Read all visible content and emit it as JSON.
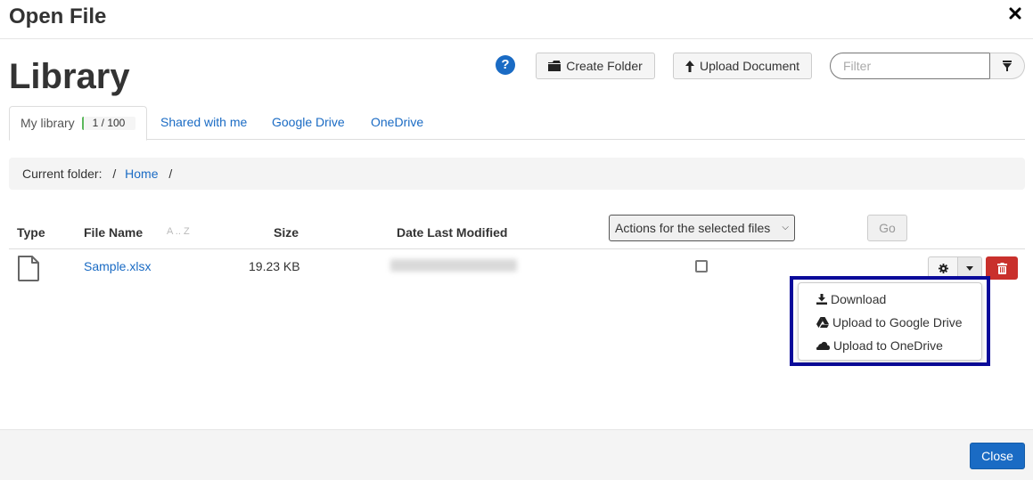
{
  "dialog": {
    "title": "Open File",
    "close_icon": "close-x-icon"
  },
  "header": {
    "title": "Library",
    "help_icon": "?",
    "create_folder_label": "Create Folder",
    "upload_document_label": "Upload Document",
    "filter_placeholder": "Filter",
    "filter_value": ""
  },
  "tabs": [
    {
      "label": "My library",
      "active": true,
      "quota_text": "1 / 100",
      "quota_used_fraction": 0.01
    },
    {
      "label": "Shared with me",
      "active": false
    },
    {
      "label": "Google Drive",
      "active": false
    },
    {
      "label": "OneDrive",
      "active": false
    }
  ],
  "breadcrumb": {
    "label": "Current folder:",
    "separator": "/",
    "items": [
      "Home"
    ]
  },
  "table": {
    "columns": {
      "type": "Type",
      "name": "File Name",
      "sort_hint": "A .. Z",
      "size": "Size",
      "date": "Date Last Modified"
    },
    "bulk_actions": {
      "selected": "Actions for the selected files",
      "go_label": "Go"
    },
    "rows": [
      {
        "type_icon": "file-icon",
        "name": "Sample.xlsx",
        "size": "19.23 KB",
        "date": "[redacted]",
        "checked": false
      }
    ]
  },
  "row_menu": {
    "items": [
      {
        "icon": "download-icon",
        "label": "Download"
      },
      {
        "icon": "google-drive-icon",
        "label": "Upload to Google Drive"
      },
      {
        "icon": "onedrive-cloud-icon",
        "label": "Upload to OneDrive"
      }
    ]
  },
  "footer": {
    "close_label": "Close"
  },
  "colors": {
    "link": "#1a6bc4",
    "primary": "#1a6bc4",
    "danger": "#c9302c",
    "highlight": "#0a0a9a",
    "quota_fill": "#5cb85c"
  }
}
